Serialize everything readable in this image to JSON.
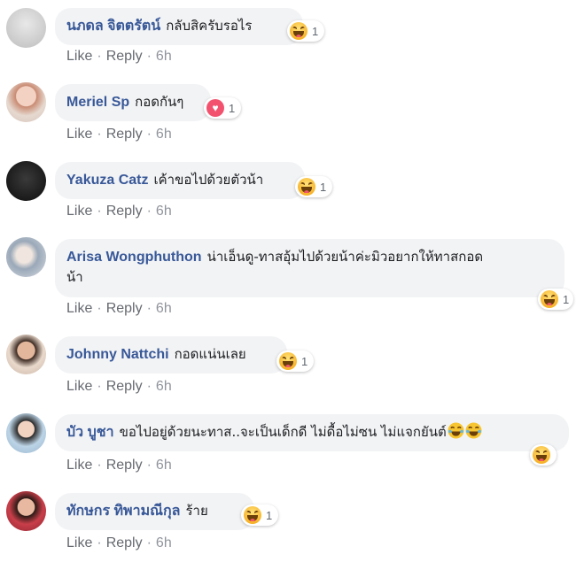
{
  "actions": {
    "like": "Like",
    "reply": "Reply",
    "separator": "·"
  },
  "comments": [
    {
      "author": "นภดล จิตตรัตน์",
      "text": "กลับสิครับรอไร",
      "reaction": "haha",
      "reaction_count": "1",
      "time": "6h"
    },
    {
      "author": "Meriel Sp",
      "text": "กอดกันๆ",
      "reaction": "love",
      "reaction_count": "1",
      "time": "6h"
    },
    {
      "author": "Yakuza Catz",
      "text": "เค้าขอไปด้วยตัวน้า",
      "reaction": "haha",
      "reaction_count": "1",
      "time": "6h"
    },
    {
      "author": "Arisa Wongphuthon",
      "text_line1": "น่าเอ็นดู-ทาสอุ้มไปด้วยน้าค่ะมิวอยากให้ทาสกอด",
      "text_line2": "น้า",
      "reaction": "haha",
      "reaction_count": "1",
      "time": "6h"
    },
    {
      "author": "Johnny Nattchi",
      "text": "กอดแน่นเลย",
      "reaction": "haha",
      "reaction_count": "1",
      "time": "6h"
    },
    {
      "author": "บัว บูชา",
      "text": "ขอไปอยู่ด้วยนะทาส..จะเป็นเด็กดี ไม่ดื้อไม่ซน ไม่แจกยันต์",
      "reaction": "haha",
      "reaction_count": "",
      "time": "6h"
    },
    {
      "author": "ทักษกร ทิพามณีกุล",
      "text": "ร้าย",
      "reaction": "haha",
      "reaction_count": "1",
      "time": "6h"
    }
  ]
}
